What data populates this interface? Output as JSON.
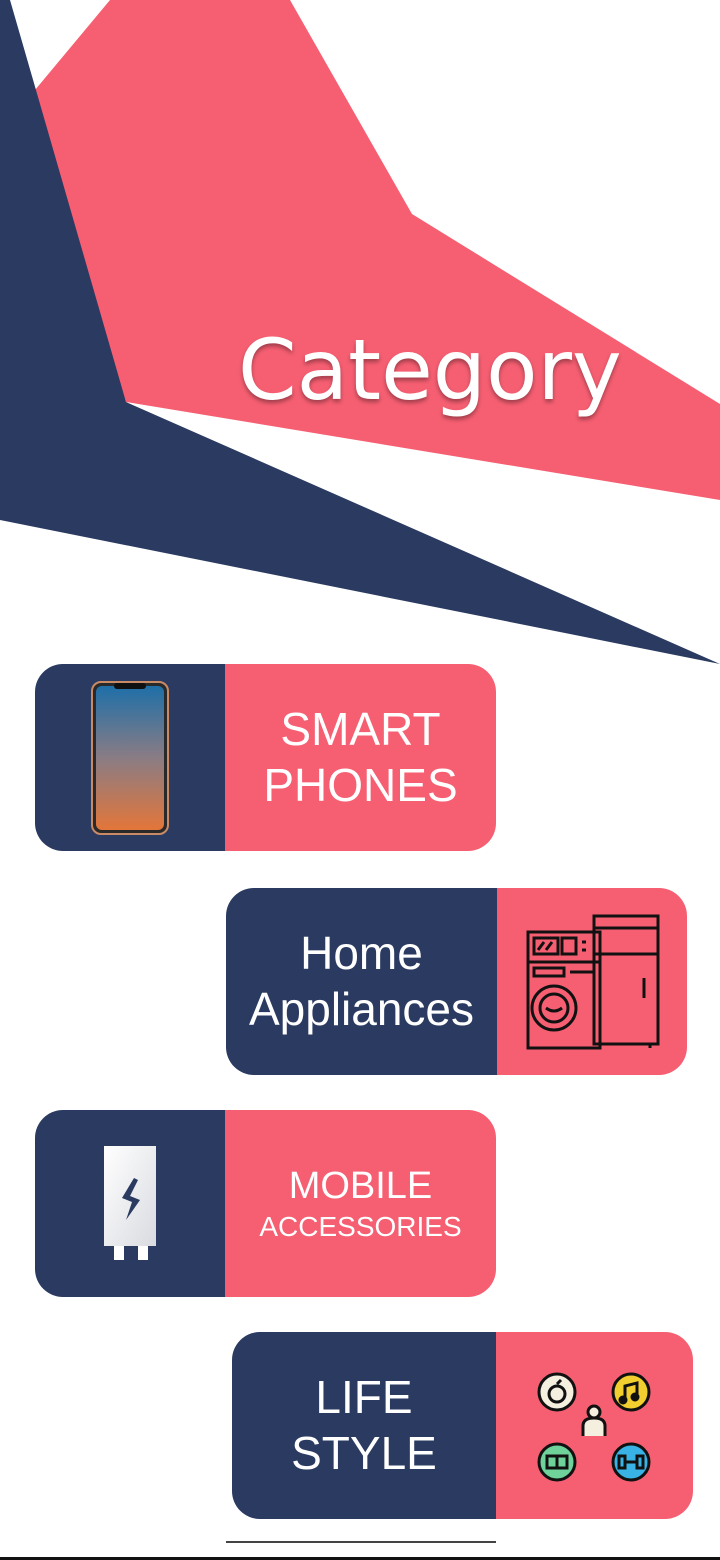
{
  "header": {
    "title": "Category"
  },
  "colors": {
    "navy": "#2a3a61",
    "coral": "#f65f72",
    "white": "#ffffff"
  },
  "categories": [
    {
      "line1": "SMART",
      "line2": "PHONES",
      "icon": "smartphone-icon"
    },
    {
      "line1": "Home",
      "line2": "Appliances",
      "icon": "home-appliances-icon"
    },
    {
      "line1": "MOBILE",
      "line2": "ACCESSORIES",
      "icon": "charger-icon"
    },
    {
      "line1": "LIFE",
      "line2": "STYLE",
      "icon": "lifestyle-icon"
    }
  ]
}
